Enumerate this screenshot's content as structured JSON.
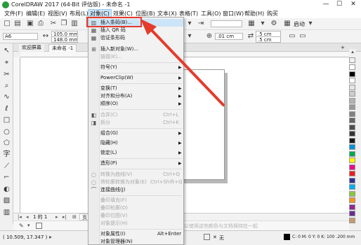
{
  "window": {
    "title": "CorelDRAW 2017 (64-Bit 评估版) - 未命名 -1",
    "minimize": "—",
    "maximize": "☐",
    "close": "✕"
  },
  "menubar": [
    {
      "label": "文件(F)"
    },
    {
      "label": "编辑(E)"
    },
    {
      "label": "视图(V)"
    },
    {
      "label": "布局(L)"
    },
    {
      "label": "对象(C)"
    },
    {
      "label": "效果(C)"
    },
    {
      "label": "位图(B)"
    },
    {
      "label": "文本(X)"
    },
    {
      "label": "表格(T)"
    },
    {
      "label": "工具(O)"
    },
    {
      "label": "窗口(W)"
    },
    {
      "label": "帮助(H)"
    },
    {
      "label": "购买"
    }
  ],
  "toolbar": {
    "launch_label": "启动"
  },
  "propertybar": {
    "page_size": "A6",
    "width": "105.0 mm",
    "height": "148.0 mm",
    "nudge": ".01 cm",
    "dup_x": ".5 cm",
    "dup_y": ".5 cm"
  },
  "doc_tabs": {
    "welcome": "欢迎屏幕",
    "document": "未命名 -1",
    "add": "+"
  },
  "object_menu": {
    "items": [
      {
        "label": "插入条码(B)..."
      },
      {
        "label": "插入 QR 码"
      },
      {
        "label": "验证条形码"
      },
      {
        "label": "插入新对象(W)..."
      },
      {
        "label": "链接(K)..."
      },
      {
        "label": "符号(Y)"
      },
      {
        "label": "PowerClip(W)"
      },
      {
        "label": "变换(T)"
      },
      {
        "label": "对齐和分布(A)"
      },
      {
        "label": "顺序(O)"
      },
      {
        "label": "合并(C)",
        "shortcut": "Ctrl+L"
      },
      {
        "label": "拆分",
        "shortcut": "Ctrl+K"
      },
      {
        "label": "组合(G)"
      },
      {
        "label": "隐藏(H)"
      },
      {
        "label": "锁定(L)"
      },
      {
        "label": "造形(P)"
      },
      {
        "label": "转换为曲线(V)",
        "shortcut": "Ctrl+Q"
      },
      {
        "label": "将轮廓转换为对象(E)",
        "shortcut": "Ctrl+Shift+Q"
      },
      {
        "label": "连接曲线(J)"
      },
      {
        "label": "叠印填充(F)"
      },
      {
        "label": "叠印轮廓(O)"
      },
      {
        "label": "叠印位图(V)"
      },
      {
        "label": "对象提示(H)"
      },
      {
        "label": "对象属性(I)",
        "shortcut": "Alt+Enter"
      },
      {
        "label": "对象管理器(N)"
      }
    ]
  },
  "pagebar": {
    "page_indicator": "1 的 1",
    "page_tab": "页 1"
  },
  "fillbar": {
    "hint": "以使用这些颜色与文档保持在一起"
  },
  "status": {
    "coords": "( 10.509, 17.347 )",
    "fill_none": "无",
    "color_info": "C: 0 M: 0 Y: 0 K: 100  .200 mm"
  },
  "colors": {
    "highlight_box": "#e43b2c",
    "arrow": "#e43b2c",
    "menu_hover": "#cce4f7"
  },
  "palette_colors": [
    "#ffffff",
    "#000000",
    "#ffffff",
    "#e5e5e5",
    "#cccccc",
    "#b3b3b3",
    "#999999",
    "#808080",
    "#666666",
    "#4d4d4d",
    "#333333",
    "#1a1a1a",
    "#0091d5",
    "#00a651",
    "#fff200",
    "#ec008c",
    "#ed1c24",
    "#2e3192",
    "#00aeef",
    "#8dc63f",
    "#f7941d",
    "#92278f",
    "#662d91",
    "#c69c6d"
  ]
}
